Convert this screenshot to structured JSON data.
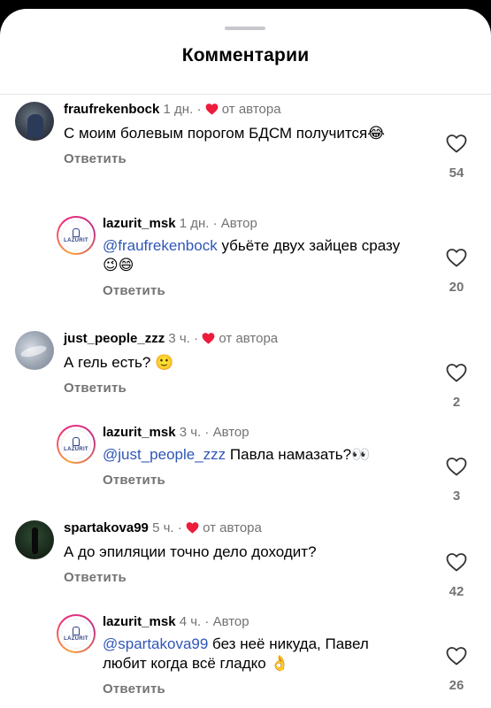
{
  "header": {
    "title": "Комментарии"
  },
  "comments": [
    {
      "username": "fraufrekenbock",
      "time": "1 дн.",
      "sep": "·",
      "badge": "от автора",
      "text": "С моим болевым порогом БДСМ получится😂",
      "reply_label": "Ответить",
      "likes": "54"
    },
    {
      "username": "lazurit_msk",
      "time": "1 дн.",
      "sep": "·",
      "badge": "Автор",
      "mention": "@fraufrekenbock",
      "text": " убьёте двух зайцев сразу 😉😄",
      "reply_label": "Ответить",
      "likes": "20",
      "avatar_label": "LAZURIT"
    },
    {
      "username": "just_people_zzz",
      "time": "3 ч.",
      "sep": "·",
      "badge": "от автора",
      "text": "А гель есть? 🙂",
      "reply_label": "Ответить",
      "likes": "2"
    },
    {
      "username": "lazurit_msk",
      "time": "3 ч.",
      "sep": "·",
      "badge": "Автор",
      "mention": "@just_people_zzz",
      "text": " Павла намазать?👀",
      "reply_label": "Ответить",
      "likes": "3",
      "avatar_label": "LAZURIT"
    },
    {
      "username": "spartakova99",
      "time": "5 ч.",
      "sep": "·",
      "badge": "от автора",
      "text": "А до эпиляции точно дело доходит?",
      "reply_label": "Ответить",
      "likes": "42"
    },
    {
      "username": "lazurit_msk",
      "time": "4 ч.",
      "sep": "·",
      "badge": "Автор",
      "mention": "@spartakova99",
      "text": " без неё никуда, Павел любит когда всё гладко 👌",
      "reply_label": "Ответить",
      "likes": "26",
      "avatar_label": "LAZURIT"
    }
  ],
  "colors": {
    "heart_red": "#ed1c3c",
    "mention_blue": "#2f56b8",
    "muted": "#737373"
  },
  "icons": {
    "like": "heart-outline-icon",
    "author_like": "heart-filled-icon"
  }
}
